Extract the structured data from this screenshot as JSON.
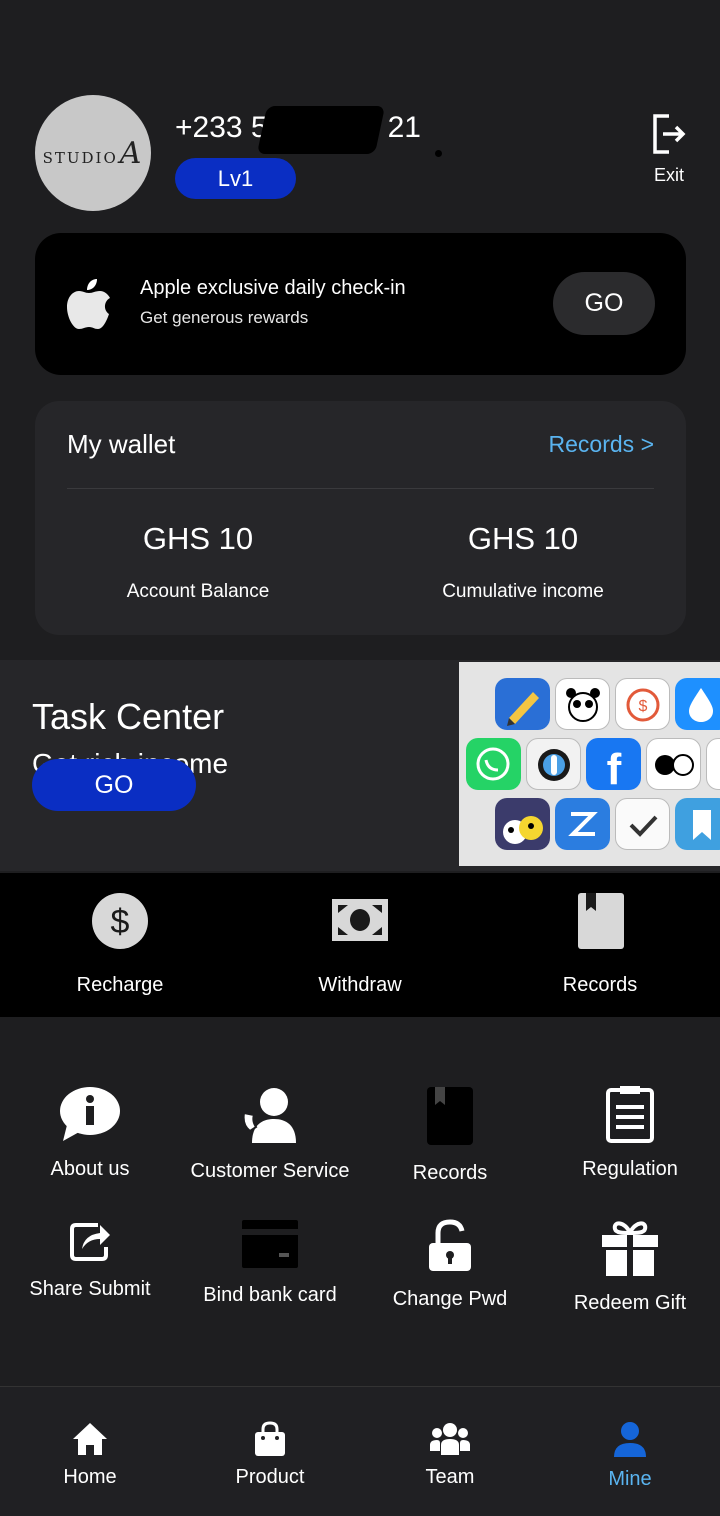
{
  "profile": {
    "avatar_text": "STUDIO",
    "avatar_letter": "A",
    "phone": "+233 5",
    "phone_tail": "21",
    "level": "Lv1",
    "exit_label": "Exit"
  },
  "checkin": {
    "title": "Apple exclusive daily check-in",
    "subtitle": "Get generous rewards",
    "button": "GO"
  },
  "wallet": {
    "title": "My wallet",
    "records_link": "Records >",
    "balance_amount": "GHS 10",
    "balance_label": "Account Balance",
    "income_amount": "GHS 10",
    "income_label": "Cumulative income"
  },
  "task_center": {
    "title": "Task Center",
    "subtitle": "Get rich income",
    "button": "GO"
  },
  "quick_actions": [
    {
      "label": "Recharge",
      "icon": "dollar-coin-icon"
    },
    {
      "label": "Withdraw",
      "icon": "banknote-icon"
    },
    {
      "label": "Records",
      "icon": "bookmark-book-icon"
    }
  ],
  "menu": [
    {
      "label": "About us",
      "icon": "info-chat-icon"
    },
    {
      "label": "Customer Service",
      "icon": "support-agent-icon"
    },
    {
      "label": "Records",
      "icon": "book-icon"
    },
    {
      "label": "Regulation",
      "icon": "clipboard-icon"
    },
    {
      "label": "Share Submit",
      "icon": "share-icon"
    },
    {
      "label": "Bind bank card",
      "icon": "credit-card-icon"
    },
    {
      "label": "Change Pwd",
      "icon": "unlock-icon"
    },
    {
      "label": "Redeem Gift",
      "icon": "gift-icon"
    }
  ],
  "nav": [
    {
      "label": "Home",
      "icon": "home-icon"
    },
    {
      "label": "Product",
      "icon": "shopping-bag-icon"
    },
    {
      "label": "Team",
      "icon": "team-icon"
    },
    {
      "label": "Mine",
      "icon": "user-icon",
      "active": true
    }
  ],
  "colors": {
    "background": "#1e1e20",
    "accent_blue": "#0a2ec3",
    "link_blue": "#5ab4f0"
  }
}
